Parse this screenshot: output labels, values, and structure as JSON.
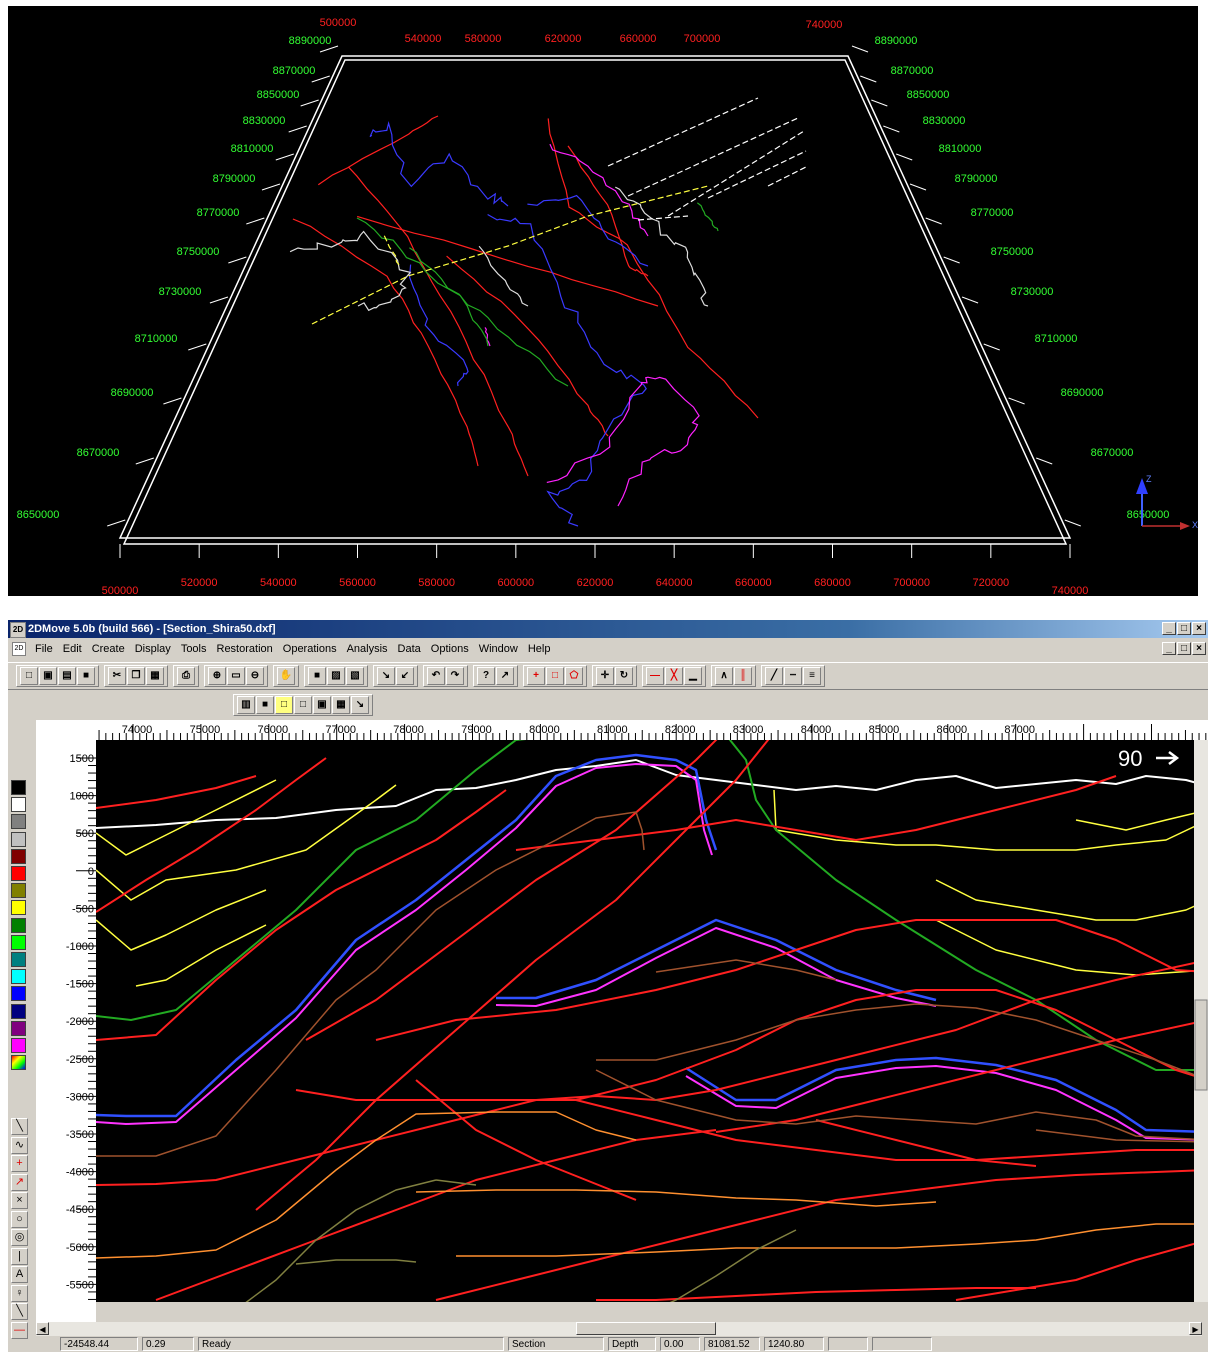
{
  "view3d": {
    "top_x_ticks": [
      "500000",
      "540000",
      "580000",
      "620000",
      "660000",
      "700000",
      "740000"
    ],
    "bottom_x_ticks": [
      "500000",
      "520000",
      "540000",
      "560000",
      "580000",
      "600000",
      "620000",
      "640000",
      "660000",
      "680000",
      "700000",
      "720000",
      "740000"
    ],
    "left_y_ticks": [
      "8890000",
      "8870000",
      "8850000",
      "8830000",
      "8810000",
      "8790000",
      "8770000",
      "8750000",
      "8730000",
      "8710000",
      "8690000",
      "8670000",
      "8650000"
    ],
    "right_y_ticks": [
      "8890000",
      "8870000",
      "8850000",
      "8830000",
      "8810000",
      "8790000",
      "8770000",
      "8750000",
      "8730000",
      "8710000",
      "8690000",
      "8670000",
      "8650000"
    ],
    "axis_gizmo": {
      "z_label": "Z",
      "x_label": "X"
    },
    "colors": {
      "x_ticks": "#ff2020",
      "y_ticks": "#33ff33",
      "frame": "#ffffff"
    }
  },
  "app": {
    "title": "2DMove 5.0b (build 566) - [Section_Shira50.dxf]",
    "icon_label": "2D",
    "window_buttons": [
      "_",
      "□",
      "×"
    ],
    "menu": [
      "File",
      "Edit",
      "Create",
      "Display",
      "Tools",
      "Restoration",
      "Operations",
      "Analysis",
      "Data",
      "Options",
      "Window",
      "Help"
    ],
    "toolbar1_groups": [
      {
        "icons": [
          "new-icon",
          "open-icon",
          "open-folder-icon",
          "save-icon"
        ]
      },
      {
        "icons": [
          "cut-icon",
          "copy-icon",
          "paste-icon"
        ]
      },
      {
        "icons": [
          "print-icon"
        ]
      },
      {
        "icons": [
          "zoom-in-icon",
          "zoom-box-icon",
          "zoom-out-icon"
        ]
      },
      {
        "icons": [
          "pan-hand-icon"
        ]
      },
      {
        "icons": [
          "save-view-icon",
          "view-window-icon",
          "view-restore-icon"
        ]
      },
      {
        "icons": [
          "export-2d-icon",
          "export-3d-icon"
        ]
      },
      {
        "icons": [
          "undo-icon",
          "redo-icon"
        ]
      },
      {
        "icons": [
          "help-icon",
          "context-help-icon"
        ]
      },
      {
        "icons": [
          "add-point-icon",
          "rectangle-icon",
          "polygon-icon"
        ]
      },
      {
        "icons": [
          "move-icon",
          "rotate-icon"
        ]
      },
      {
        "icons": [
          "horizontal-line-icon",
          "cross-line-icon",
          "baseline-icon"
        ]
      },
      {
        "icons": [
          "fold-icon",
          "fault-icon"
        ]
      },
      {
        "icons": [
          "diagonal-icon",
          "dashed-line-icon",
          "offset-line-icon"
        ]
      }
    ],
    "toolbar2_icons": [
      "layer-icon",
      "fill-icon",
      "yellow-box-icon",
      "blank-box-icon",
      "window-box-icon",
      "stack-icon",
      "pin-icon"
    ],
    "ruler_ticks": [
      "74000",
      "75000",
      "76000",
      "77000",
      "78000",
      "79000",
      "80000",
      "81000",
      "82000",
      "83000",
      "84000",
      "85000",
      "86000",
      "87000"
    ],
    "depth_ticks": [
      "1500",
      "1000",
      "500",
      "0",
      "-500",
      "-1000",
      "-1500",
      "-2000",
      "-2500",
      "-3000",
      "-3500",
      "-4000",
      "-4500",
      "-5000",
      "-5500"
    ],
    "view_angle": "90",
    "palette": [
      "#000000",
      "#ffffff",
      "#808080",
      "#c0c0c0",
      "#800000",
      "#ff0000",
      "#808000",
      "#ffff00",
      "#008000",
      "#00ff00",
      "#008080",
      "#00ffff",
      "#0000ff",
      "#000080",
      "#800080",
      "#ff00ff"
    ],
    "tool_icons": [
      "smooth-curve-icon",
      "wave-curve-icon",
      "cross-icon",
      "arrow-icon",
      "delete-x-icon",
      "circle-icon",
      "target-icon",
      "vertical-line-icon",
      "text-A-icon",
      "stamp-icon",
      "line-icon",
      "red-line-icon"
    ],
    "tool_glyphs": [
      "╲",
      "∿",
      "+",
      "↗",
      "×",
      "○",
      "◎",
      "|",
      "A",
      "♀",
      "╲",
      "—"
    ],
    "status": {
      "x": "-24548.44",
      "scale": "0.29",
      "message": "Ready",
      "mode": "Section",
      "axis": "Depth",
      "v1": "0.00",
      "v2": "81081.52",
      "v3": "1240.80"
    }
  }
}
